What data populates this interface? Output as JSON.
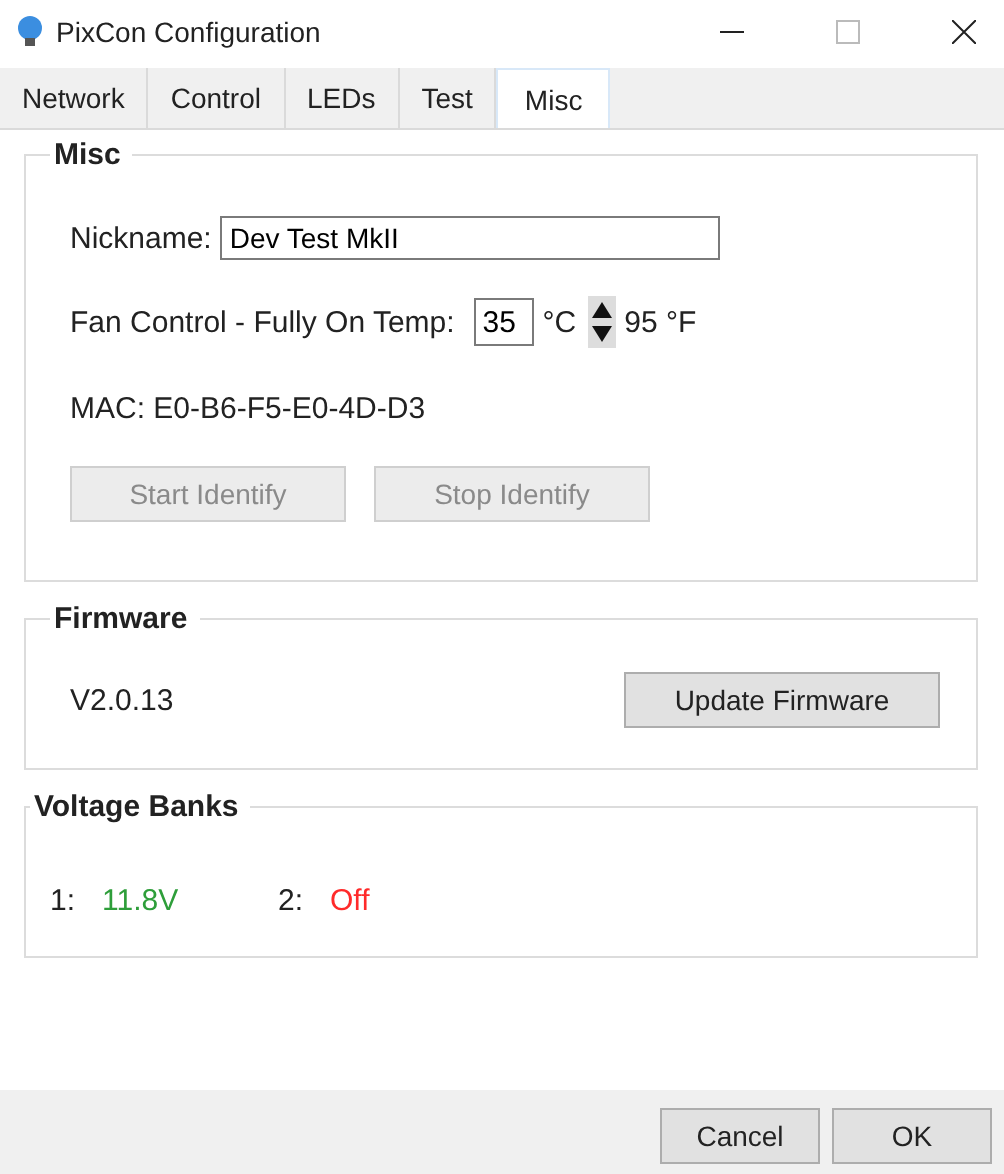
{
  "window": {
    "title": "PixCon Configuration"
  },
  "tabs": [
    {
      "label": "Network",
      "selected": false
    },
    {
      "label": "Control",
      "selected": false
    },
    {
      "label": "LEDs",
      "selected": false
    },
    {
      "label": "Test",
      "selected": false
    },
    {
      "label": "Misc",
      "selected": true
    }
  ],
  "misc": {
    "title": "Misc",
    "nickname_label": "Nickname:",
    "nickname_value": "Dev Test MkII",
    "fan_label": "Fan Control - Fully On Temp:",
    "fan_value": "35",
    "celsius_unit": "°C",
    "fahrenheit": "95 °F",
    "mac": "MAC: E0-B6-F5-E0-4D-D3",
    "buttons": [
      {
        "label": "Start Identify",
        "disabled": true
      },
      {
        "label": "Stop Identify",
        "disabled": true
      }
    ]
  },
  "firmware": {
    "title": "Firmware",
    "version": "V2.0.13",
    "button": "Update Firmware"
  },
  "voltage_banks": {
    "title": "Voltage Banks",
    "banks": [
      {
        "label": "1:",
        "value": "11.8V",
        "color": "#2e9e3a"
      },
      {
        "label": "2:",
        "value": "Off",
        "color": "#ff2a2a"
      }
    ]
  },
  "buttons": [
    "Cancel",
    "OK"
  ]
}
